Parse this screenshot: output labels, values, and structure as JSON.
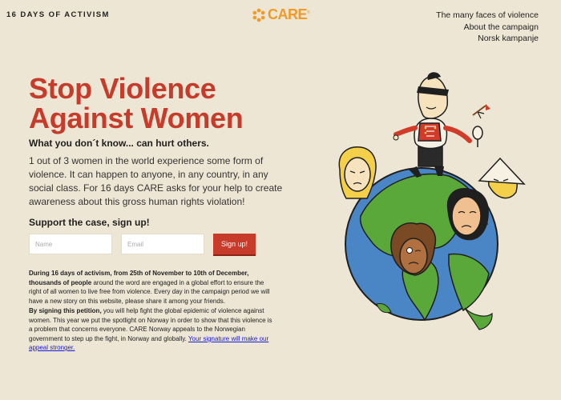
{
  "header": {
    "brand": "16 DAYS OF ACTIVISM",
    "logo_text": "CARE",
    "nav": [
      "The many faces of violence",
      "About the campaign",
      "Norsk kampanje"
    ]
  },
  "hero": {
    "title_line1": "Stop Violence",
    "title_line2": "Against Women",
    "subhead": "What you don´t know... can hurt others.",
    "intro": "1 out of 3 women in the world experience some form of violence. It can happen to anyone, in any country, in any social class. For 16 days CARE asks for your help to create awareness about this gross human rights violation!"
  },
  "form": {
    "heading": "Support the case, sign up!",
    "name_placeholder": "Name",
    "email_placeholder": "Email",
    "submit_label": "Sign up!"
  },
  "body": {
    "p1_bold": "During 16 days of activism, from 25th of November to 10th of December, thousands of people",
    "p1_rest": " around the word are engaged in a global effort to ensure the right of all women to live free from violence. Every day in the campaign period we will have a new story on this website, please share it among your friends.",
    "p2_bold": "By signing this petition,",
    "p2_rest": " you will help fight the global epidemic of violence against women. This year we put the spotlight on Norway in order to show that this violence is a problem that concerns everyone. CARE Norway appeals to the Norwegian government to step up the fight, in  Norway and globally. ",
    "p2_link": "Your signature will make our appeal stronger."
  },
  "colors": {
    "background": "#ede6d5",
    "accent_red": "#c73b2a",
    "logo_orange": "#f09a2a",
    "ocean_blue": "#4a86c5",
    "land_green": "#5aa83a"
  },
  "illustration": {
    "subject": "cartoon-globe-with-characters"
  }
}
